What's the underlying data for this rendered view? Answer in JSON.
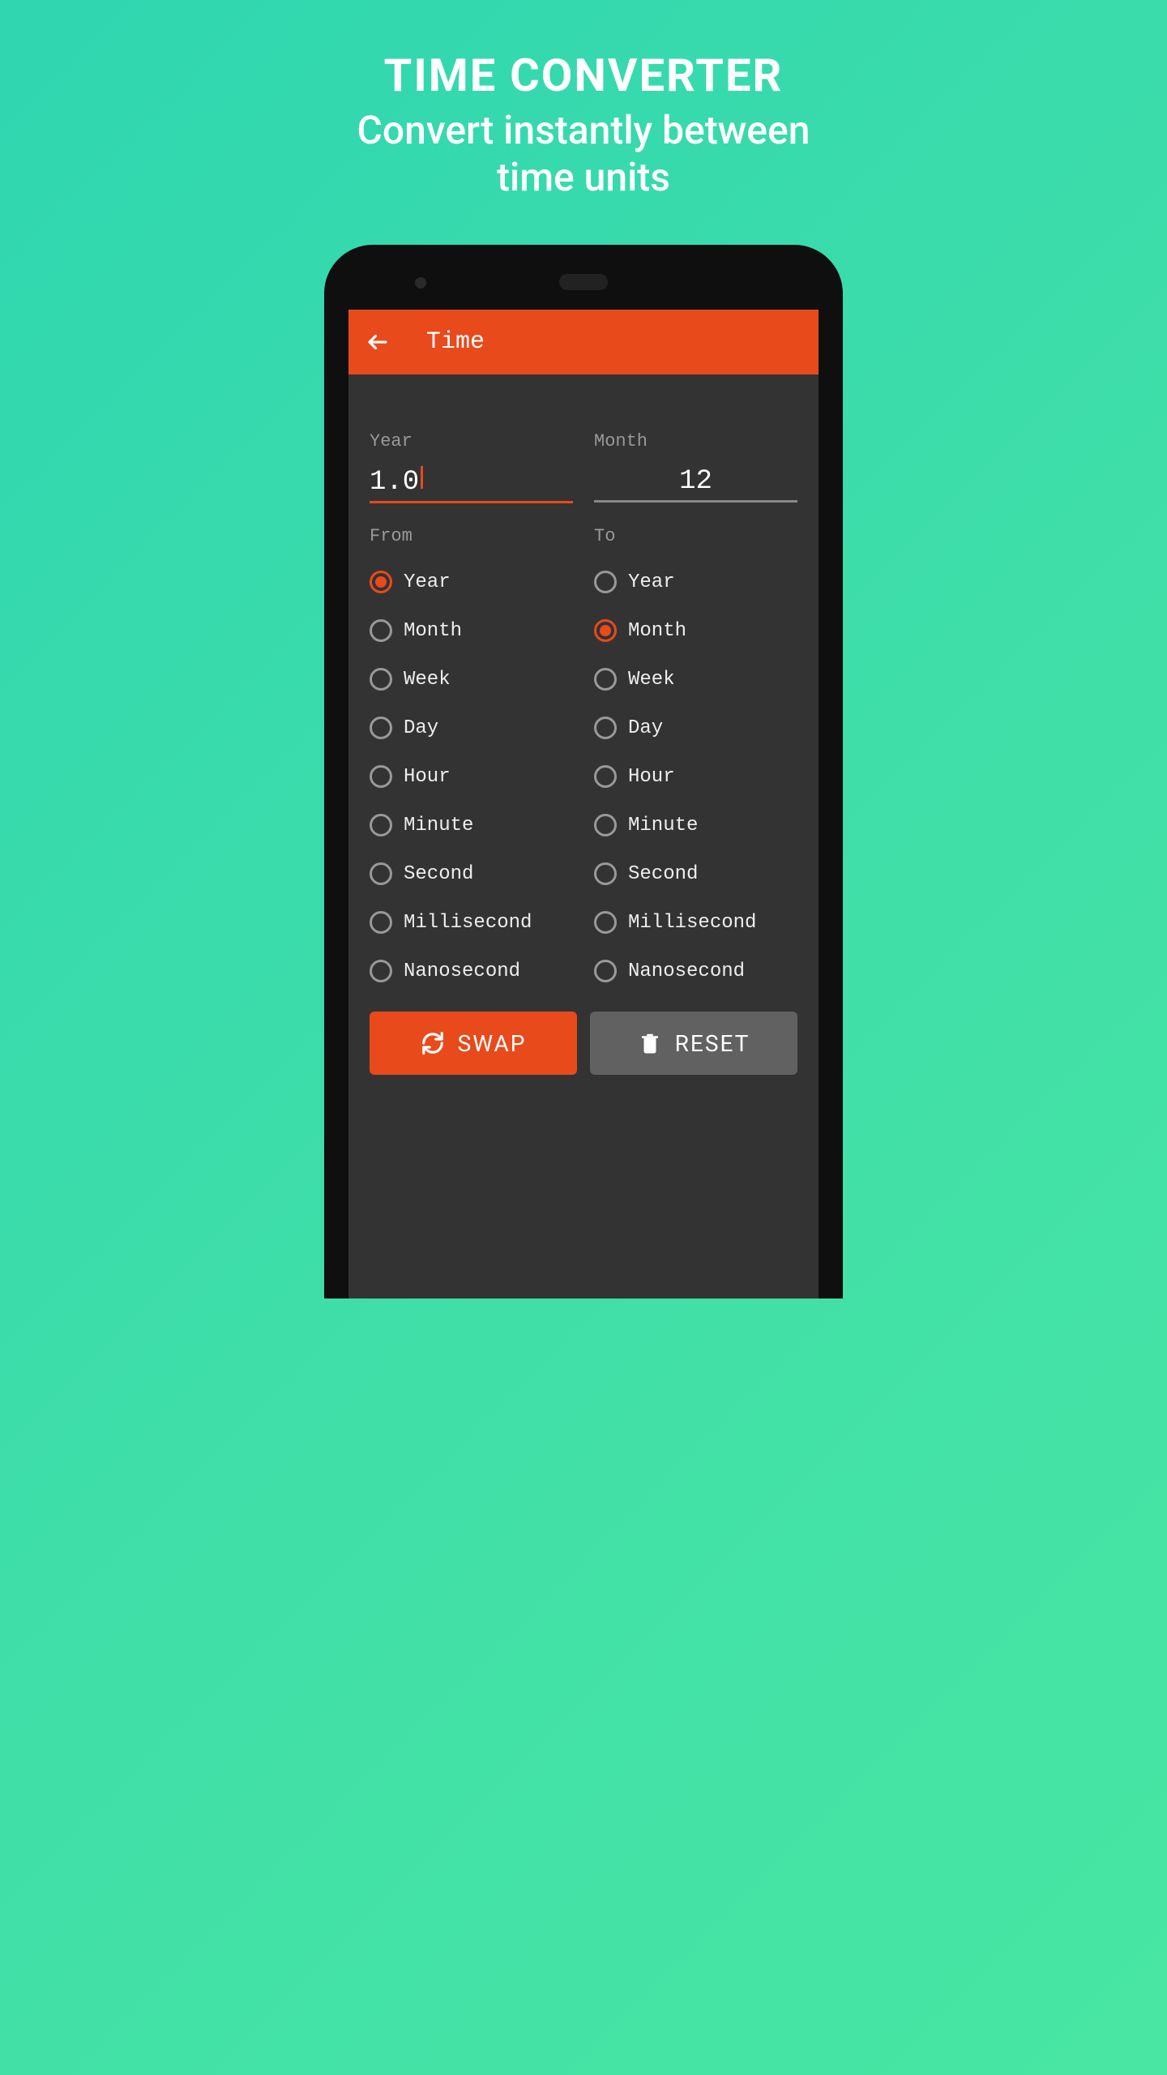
{
  "promo": {
    "title": "TIME CONVERTER",
    "subtitle_line1": "Convert instantly between",
    "subtitle_line2": "time units"
  },
  "header": {
    "title": "Time"
  },
  "input": {
    "from_label": "Year",
    "to_label": "Month",
    "from_value": "1.0",
    "to_value": "12"
  },
  "columns": {
    "from_heading": "From",
    "to_heading": "To"
  },
  "units": [
    "Year",
    "Month",
    "Week",
    "Day",
    "Hour",
    "Minute",
    "Second",
    "Millisecond",
    "Nanosecond"
  ],
  "selected": {
    "from_index": 0,
    "to_index": 1
  },
  "buttons": {
    "swap": "SWAP",
    "reset": "RESET"
  },
  "colors": {
    "accent": "#E84A1C",
    "bg_gradient_start": "#2FD6B0",
    "bg_gradient_end": "#48E6A2",
    "screen_bg": "#333333"
  }
}
